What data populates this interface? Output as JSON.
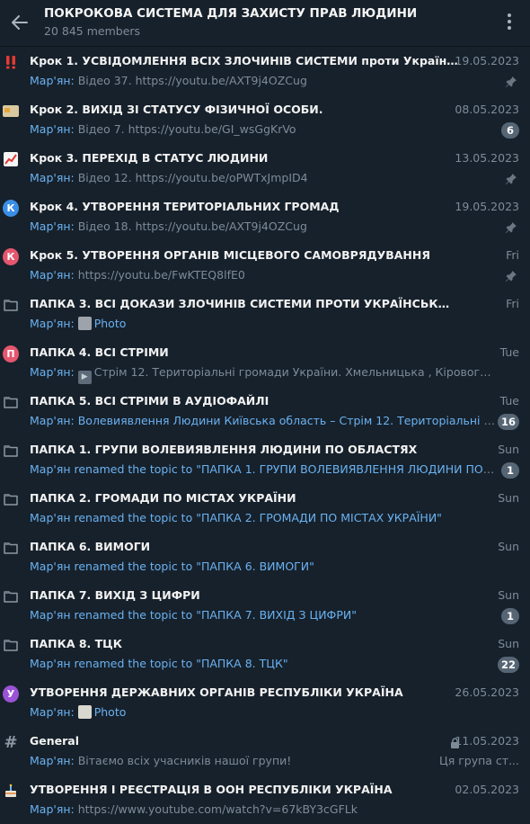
{
  "header": {
    "title": "ПОКРОКОВА СИСТЕМА ДЛЯ ЗАХИСТУ ПРАВ ЛЮДИНИ",
    "members": "20 845 members"
  },
  "colors": {
    "background": "#17212b",
    "accent": "#6ab2f2",
    "muted": "#7d8b99",
    "badge": "#566574"
  },
  "topics": [
    {
      "icon": "double-exclamation-icon",
      "title": "Крок 1. УСВІДОМЛЕННЯ ВСІХ ЗЛОЧИНІВ СИСТЕМИ проти Українського Н...",
      "date": "19.05.2023",
      "sender": "Мар'ян:",
      "message": "Відео 37. https://youtu.be/AXT9j4OZCug",
      "pinned": true
    },
    {
      "icon": "id-card-icon",
      "title": "Крок 2. ВИХІД ЗІ СТАТУСУ ФІЗИЧНОЇ ОСОБИ.",
      "date": "08.05.2023",
      "sender": "Мар'ян:",
      "message": "Відео 7. https://youtu.be/GI_wsGgKrVo",
      "badge": "6"
    },
    {
      "icon": "chart-icon",
      "title": "Крок 3. ПЕРЕХІД В СТАТУС ЛЮДИНИ",
      "date": "13.05.2023",
      "sender": "Мар'ян:",
      "message": "Відео 12. https://youtu.be/oPWTxJmpID4",
      "pinned": true
    },
    {
      "icon": "letter-k-blue-icon",
      "letter": "К",
      "title": "Крок 4. УТВОРЕННЯ ТЕРИТОРІАЛЬНИХ ГРОМАД",
      "date": "19.05.2023",
      "sender": "Мар'ян:",
      "message": "Відео 18. https://youtu.be/AXT9j4OZCug",
      "pinned": true
    },
    {
      "icon": "letter-k-pink-icon",
      "letter": "К",
      "title": "Крок 5. УТВОРЕННЯ ОРГАНІВ МІСЦЕВОГО САМОВРЯДУВАННЯ",
      "date": "Fri",
      "sender": "Мар'ян:",
      "message": "https://youtu.be/FwKTEQ8lfE0",
      "pinned": true
    },
    {
      "icon": "folder-icon",
      "title": "ПАПКА 3. ВСІ ДОКАЗИ ЗЛОЧИНІВ СИСТЕМИ ПРОТИ УКРАЇНСЬКОГО НАРОДУ",
      "date": "Fri",
      "sender": "Мар'ян:",
      "message": "Photo",
      "thumb": "photo",
      "message_link": true
    },
    {
      "icon": "letter-p-pink-icon",
      "letter": "П",
      "title": "ПАПКА 4. ВСІ СТРІМИ",
      "date": "Tue",
      "sender": "Мар'ян:",
      "message": "Стрім 12. Територіальні громади України. Хмельницька , Кіровоградська, ...",
      "thumb": "video"
    },
    {
      "icon": "folder-icon",
      "title": "ПАПКА 5. ВСІ СТРІМИ В АУДІОФАЙЛІ",
      "date": "Tue",
      "sender": "Мар'ян:",
      "message": "Волевиявлення Людини Київська область – Стрім 12. Територіальні гром...",
      "message_link": true,
      "badge": "16"
    },
    {
      "icon": "folder-icon",
      "title": "ПАПКА 1. ГРУПИ ВОЛЕВИЯВЛЕННЯ ЛЮДИНИ ПО ОБЛАСТЯХ",
      "date": "Sun",
      "sender": "",
      "message": "Мар'ян renamed the topic to \"ПАПКА 1. ГРУПИ ВОЛЕВИЯВЛЕННЯ ЛЮДИНИ ПО ОБ...",
      "message_link": true,
      "badge": "1"
    },
    {
      "icon": "folder-icon",
      "title": "ПАПКА 2. ГРОМАДИ ПО МІСТАХ УКРАЇНИ",
      "date": "Sun",
      "sender": "",
      "message": "Мар'ян renamed the topic to \"ПАПКА 2. ГРОМАДИ ПО МІСТАХ УКРАЇНИ\"",
      "message_link": true
    },
    {
      "icon": "folder-icon",
      "title": "ПАПКА 6. ВИМОГИ",
      "date": "Sun",
      "sender": "",
      "message": "Мар'ян renamed the topic to \"ПАПКА 6. ВИМОГИ\"",
      "message_link": true
    },
    {
      "icon": "folder-icon",
      "title": "ПАПКА 7. ВИХІД З ЦИФРИ",
      "date": "Sun",
      "sender": "",
      "message": "Мар'ян renamed the topic to \"ПАПКА 7. ВИХІД З ЦИФРИ\"",
      "message_link": true,
      "badge": "1"
    },
    {
      "icon": "folder-icon",
      "title": "ПАПКА 8. ТЦК",
      "date": "Sun",
      "sender": "",
      "message": "Мар'ян renamed the topic to \"ПАПКА 8. ТЦК\"",
      "message_link": true,
      "badge": "22"
    },
    {
      "icon": "letter-u-purple-icon",
      "letter": "У",
      "title": "УТВОРЕННЯ ДЕРЖАВНИХ ОРГАНІВ РЕСПУБЛІКИ УКРАЇНА",
      "date": "26.05.2023",
      "sender": "Мар'ян:",
      "message": "Photo",
      "thumb": "doc",
      "message_link": true
    },
    {
      "icon": "hash-icon",
      "title": "General",
      "date": "11.05.2023",
      "locked": true,
      "sender": "Мар'ян:",
      "message": "Вітаємо всіх учасників нашої групи!",
      "note": "Ця група ст..."
    },
    {
      "icon": "cake-icon",
      "title": "УТВОРЕННЯ І РЕЄСТРАЦІЯ В ООН РЕСПУБЛІКИ УКРАЇНА",
      "date": "02.05.2023",
      "sender": "Мар'ян:",
      "message": "https://www.youtube.com/watch?v=67kBY3cGFLk"
    }
  ]
}
